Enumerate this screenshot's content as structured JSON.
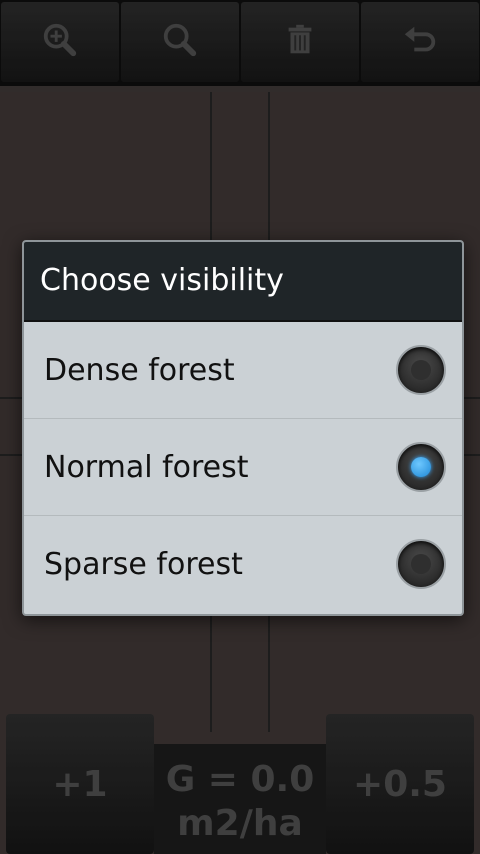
{
  "toolbar": {
    "buttons": [
      {
        "icon": "zoom-in-icon"
      },
      {
        "icon": "search-icon"
      },
      {
        "icon": "trash-icon"
      },
      {
        "icon": "undo-icon"
      }
    ]
  },
  "dialog": {
    "title": "Choose visibility",
    "options": [
      {
        "label": "Dense forest",
        "selected": false
      },
      {
        "label": "Normal forest",
        "selected": true
      },
      {
        "label": "Sparse forest",
        "selected": false
      }
    ]
  },
  "bottom": {
    "left_label": "+1",
    "center_line1": "G = 0.0",
    "center_line2": "m2/ha",
    "right_label": "+0.5"
  },
  "colors": {
    "accent": "#1e88d6",
    "dialog_bg": "#cbd1d5",
    "title_bg": "#1f2528"
  }
}
